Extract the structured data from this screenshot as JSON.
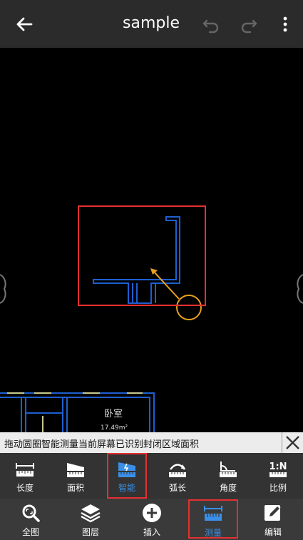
{
  "header": {
    "title": "sample"
  },
  "canvas": {
    "room_label": "卧室",
    "room_area": "17.49m²"
  },
  "message": {
    "text": "拖动圆圈智能测量当前屏幕已识别封闭区域面积"
  },
  "measure_tools": [
    {
      "label": "长度",
      "icon": "length-ruler-icon"
    },
    {
      "label": "面积",
      "icon": "area-icon"
    },
    {
      "label": "智能",
      "icon": "smart-measure-icon",
      "active": true
    },
    {
      "label": "弧长",
      "icon": "arc-length-icon"
    },
    {
      "label": "角度",
      "icon": "angle-icon"
    },
    {
      "label": "比例",
      "icon": "scale-ratio-icon",
      "icon_text": "1:N"
    }
  ],
  "bottom_nav": [
    {
      "label": "全图",
      "icon": "full-view-icon"
    },
    {
      "label": "图层",
      "icon": "layers-icon"
    },
    {
      "label": "插入",
      "icon": "insert-plus-icon"
    },
    {
      "label": "测量",
      "icon": "measure-icon",
      "active": true
    },
    {
      "label": "编辑",
      "icon": "edit-icon"
    }
  ],
  "colors": {
    "accent": "#3a8fe8",
    "highlight": "#e53030",
    "circle": "#e8a020",
    "plan_lines": "#1e5fd0"
  }
}
